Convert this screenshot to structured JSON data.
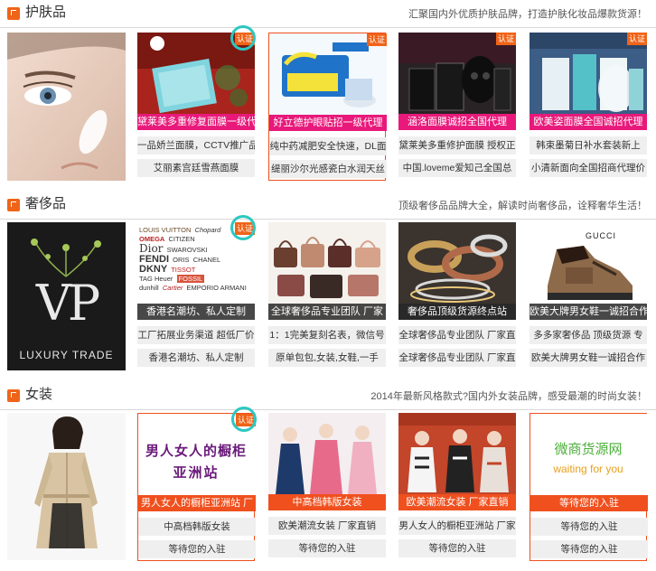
{
  "sections": [
    {
      "title": "护肤品",
      "slogan": "汇聚国内外优质护肤品牌，打造护肤化妆品爆款货源！",
      "cards": [
        {
          "caption": "黛莱美多重修复面膜一级代",
          "badge": "认证",
          "links": [
            "一品娇兰面膜，CCTV推广品",
            "艾丽素宫廷雪燕面膜"
          ]
        },
        {
          "caption": "好立德护眼贴招一级代理",
          "badge": "认证",
          "links": [
            "纯中药减肥安全快速，DL面",
            "缇丽沙尔光感瓷白水润天丝"
          ]
        },
        {
          "caption": "涵洛面膜诚招全国代理",
          "badge": "认证",
          "links": [
            "黛莱美多重修护面膜 授权正",
            "中国.loveme爱知己全国总"
          ]
        },
        {
          "caption": "欧美姿面膜全国诚招代理",
          "badge": "认证",
          "links": [
            "韩束墨菊日补水套装新上",
            "小清新面向全国招商代理价"
          ]
        }
      ]
    },
    {
      "title": "奢侈品",
      "slogan": "顶级奢侈品品牌大全，解读时尚奢侈品，诠释奢华生活！",
      "feature_text": {
        "logo": "VP",
        "tag": "LUXURY TRADE"
      },
      "brands": [
        "LOUIS VUITTON",
        "Chopard",
        "OMEGA",
        "CITIZEN",
        "Dior",
        "SWAROVSKI",
        "FENDI",
        "ORIS",
        "CHANEL",
        "DKNY",
        "TISSOT",
        "TAG Heuer",
        "FOSSIL",
        "dunhill",
        "Cartier",
        "EMPORIO ARMANI"
      ],
      "cards": [
        {
          "caption": "香港名潮坊、私人定制",
          "badge": "认证",
          "links": [
            "工厂拓展业务渠道 超低厂价",
            "香港名潮坊、私人定制"
          ]
        },
        {
          "caption": "全球奢侈品专业团队 厂家",
          "badge": "",
          "links": [
            "1：1完美复刻名表，微信号",
            "原单包包,女装,女鞋,一手"
          ]
        },
        {
          "caption": "奢侈品顶级货源终点站",
          "badge": "",
          "links": [
            "全球奢侈品专业团队 厂家直",
            "全球奢侈品专业团队 厂家直"
          ]
        },
        {
          "caption": "欧美大牌男女鞋一诚招合作",
          "badge": "",
          "brand": "GUCCI",
          "links": [
            "多多家奢侈品 顶级货源 专",
            "欧美大牌男女鞋一诚招合作"
          ]
        }
      ]
    },
    {
      "title": "女装",
      "slogan": "2014年最新风格款式?国内外女装品牌，感受最潮的时尚女装！",
      "cards": [
        {
          "caption": "男人女人的橱柜亚洲站 厂",
          "badge": "认证",
          "art_line1": "男人女人的橱柜",
          "art_line2": "亚洲站",
          "links": [
            "中高档韩版女装",
            "等待您的入驻"
          ]
        },
        {
          "caption": "中高档韩版女装",
          "badge": "",
          "links": [
            "欧美潮流女装 厂家直销",
            "等待您的入驻"
          ]
        },
        {
          "caption": "欧美潮流女装 厂家直销",
          "badge": "",
          "links": [
            "男人女人的橱柜亚洲站 厂家",
            "等待您的入驻"
          ]
        },
        {
          "caption": "等待您的入驻",
          "badge": "",
          "art_line1": "微商货源网",
          "art_line2": "waiting for you",
          "links": [
            "等待您的入驻",
            "等待您的入驻"
          ]
        }
      ]
    }
  ]
}
